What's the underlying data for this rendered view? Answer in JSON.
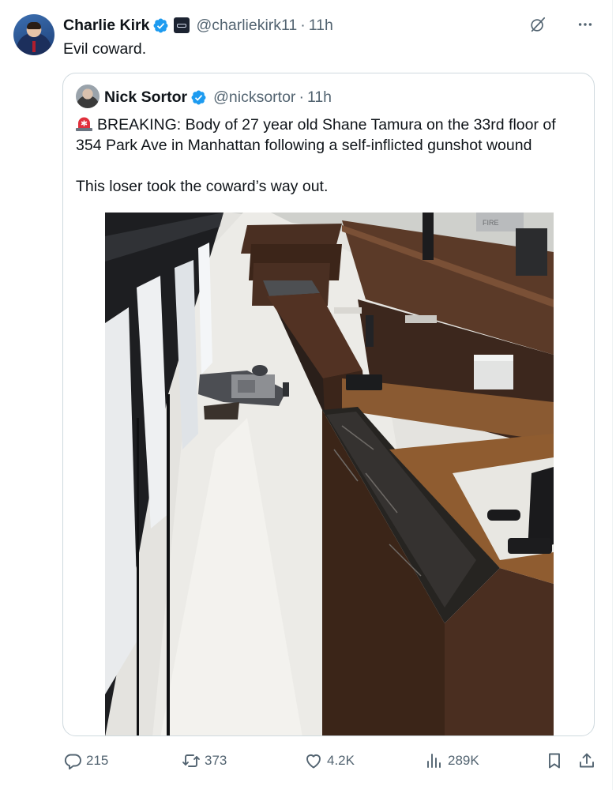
{
  "tweet": {
    "author_name": "Charlie Kirk",
    "handle": "@charliekirk11",
    "separator": "·",
    "time": "11h",
    "text": "Evil coward.",
    "avatar_icon": "profile-photo",
    "verified_icon": "verified-badge-icon",
    "affiliation_icon": "affiliate-badge-icon"
  },
  "quote": {
    "author_name": "Nick Sortor",
    "handle": "@nicksortor",
    "separator": "·",
    "time": "11h",
    "line1": "BREAKING: Body of 27 year old Shane Tamura on the 33rd floor of 354 Park Ave in Manhattan following a self-inflicted gunshot wound",
    "line2": "This loser took the coward’s way out.",
    "emoji_icon": "siren-icon",
    "media": {
      "description_icon": "office-lobby-security-photo",
      "sign_text": "FIRE"
    }
  },
  "actions": {
    "replies": "215",
    "reposts": "373",
    "likes": "4.2K",
    "views": "289K"
  },
  "colors": {
    "text_primary": "#0f1419",
    "text_secondary": "#536471",
    "verified_blue": "#1d9bf0",
    "border": "#cfd9de"
  }
}
